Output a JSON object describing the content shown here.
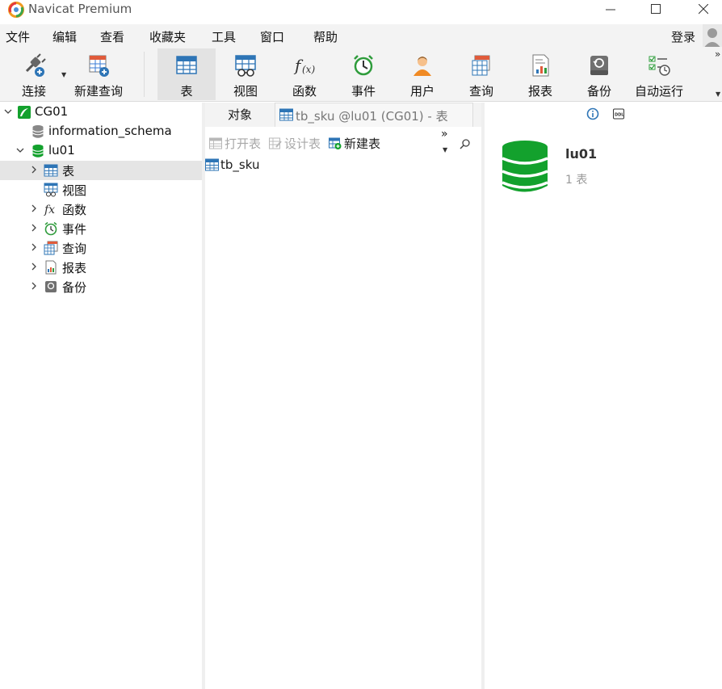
{
  "window": {
    "title": "Navicat Premium"
  },
  "menu": {
    "items": [
      "文件",
      "编辑",
      "查看",
      "收藏夹",
      "工具",
      "窗口",
      "帮助"
    ],
    "login": "登录"
  },
  "toolbar": {
    "items": [
      {
        "label": "连接",
        "icon": "connect-icon"
      },
      {
        "label": "新建查询",
        "icon": "new-query-icon"
      },
      {
        "label": "表",
        "icon": "table-icon",
        "active": true
      },
      {
        "label": "视图",
        "icon": "view-icon"
      },
      {
        "label": "函数",
        "icon": "function-icon"
      },
      {
        "label": "事件",
        "icon": "event-icon"
      },
      {
        "label": "用户",
        "icon": "user-icon"
      },
      {
        "label": "查询",
        "icon": "query-icon"
      },
      {
        "label": "报表",
        "icon": "report-icon"
      },
      {
        "label": "备份",
        "icon": "backup-icon"
      },
      {
        "label": "自动运行",
        "icon": "automation-icon"
      }
    ]
  },
  "tree": {
    "connection": "CG01",
    "databases": [
      "information_schema",
      "lu01"
    ],
    "children": [
      "表",
      "视图",
      "函数",
      "事件",
      "查询",
      "报表",
      "备份"
    ],
    "selected": "表"
  },
  "middle": {
    "tabs": {
      "objects": "对象",
      "doc": "tb_sku @lu01 (CG01) - 表"
    },
    "tools": {
      "open": "打开表",
      "design": "设计表",
      "new": "新建表",
      "more": "»"
    },
    "objects": [
      "tb_sku"
    ]
  },
  "right": {
    "db_name": "lu01",
    "count": "1 表"
  },
  "colors": {
    "accent": "#2e75b6",
    "db_green": "#13a12d",
    "selected_row": "#e5e5e5"
  }
}
